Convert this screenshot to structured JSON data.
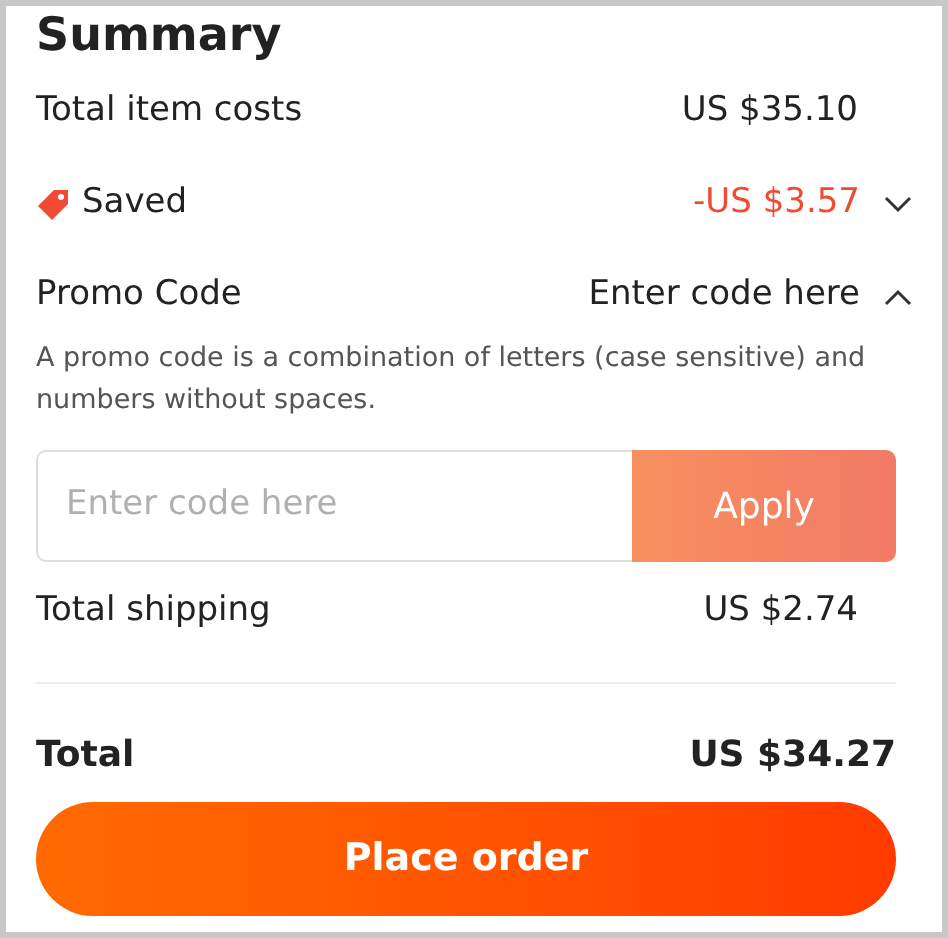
{
  "title": "Summary",
  "item_costs": {
    "label": "Total item costs",
    "value": "US $35.10"
  },
  "saved": {
    "label": "Saved",
    "value": "-US $3.57",
    "expanded": false
  },
  "promo": {
    "label": "Promo Code",
    "value": "Enter code here",
    "expanded": true,
    "description": "A promo code is a combination of letters (case sensitive) and numbers without spaces.",
    "placeholder": "Enter code here",
    "apply": {
      "label": "Apply",
      "disabled": true
    }
  },
  "shipping": {
    "label": "Total shipping",
    "value": "US $2.74"
  },
  "total": {
    "label": "Total",
    "value": "US $34.27"
  },
  "place_order": "Place order"
}
